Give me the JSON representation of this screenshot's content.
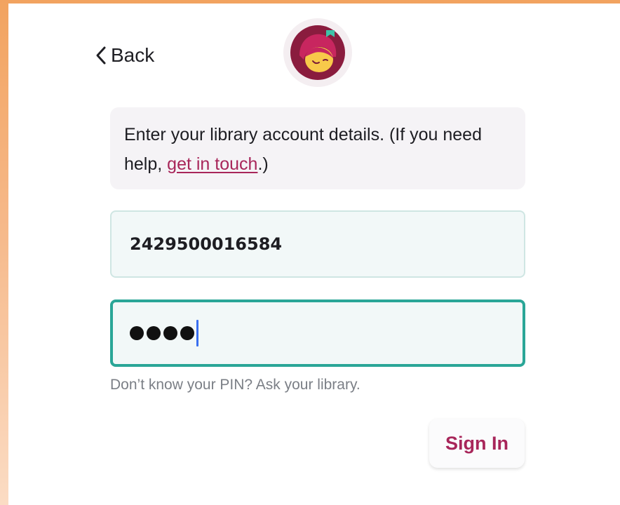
{
  "nav": {
    "back_label": "Back",
    "back_icon": "chevron-left-icon"
  },
  "brand": {
    "logo_icon": "libby-logo-icon",
    "colors": {
      "primary": "#a8265a",
      "logo_bg": "#8a1c3e"
    }
  },
  "info": {
    "text_before": "Enter your library account details. (If you need help, ",
    "link_label": "get in touch",
    "text_after": ".)"
  },
  "form": {
    "card_number": {
      "value": "2429500016584"
    },
    "pin": {
      "masked_length": 4,
      "focused": true,
      "focus_color": "#2aa697"
    },
    "pin_hint": "Don’t know your PIN? Ask your library."
  },
  "actions": {
    "sign_in_label": "Sign In"
  }
}
